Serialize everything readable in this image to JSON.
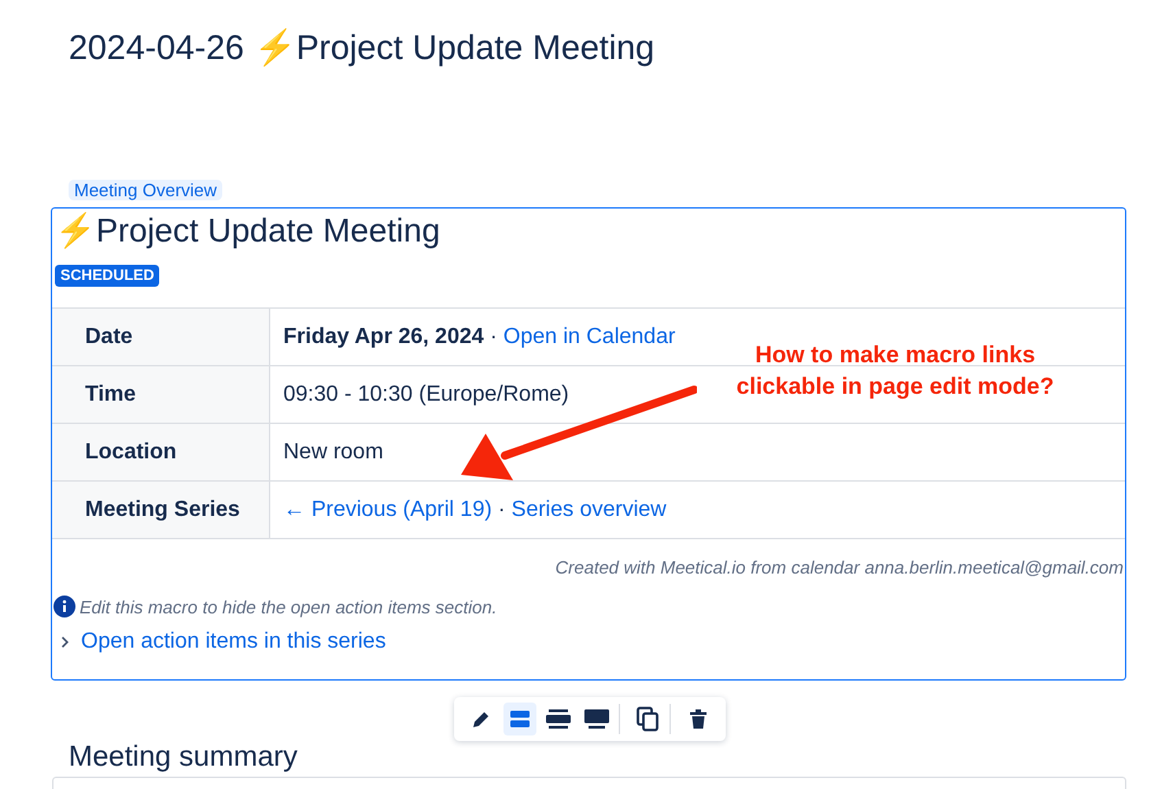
{
  "page_title": "2024-04-26 ⚡Project Update Meeting",
  "macro": {
    "label": "Meeting Overview",
    "heading": "⚡Project Update Meeting",
    "status": "SCHEDULED",
    "rows": [
      {
        "label": "Date",
        "value": [
          {
            "kind": "bold",
            "text": "Friday Apr 26, 2024"
          },
          {
            "kind": "text",
            "text": " · "
          },
          {
            "kind": "link",
            "text": "Open in Calendar"
          }
        ]
      },
      {
        "label": "Time",
        "value": [
          {
            "kind": "text",
            "text": "09:30 - 10:30 (Europe/Rome)"
          }
        ]
      },
      {
        "label": "Location",
        "value": [
          {
            "kind": "text",
            "text": "New room"
          }
        ]
      },
      {
        "label": "Meeting Series",
        "value": [
          {
            "kind": "link",
            "text": "← Previous (April 19)"
          },
          {
            "kind": "text",
            "text": " · "
          },
          {
            "kind": "link",
            "text": "Series overview"
          }
        ]
      }
    ],
    "footer": "Created with Meetical.io from calendar anna.berlin.meetical@gmail.com",
    "info_note": "Edit this macro to hide the open action items section.",
    "expander": {
      "label": "Open action items in this series",
      "expanded": false
    }
  },
  "annotation": {
    "lines": [
      "How to make macro links",
      "clickable in page edit mode?"
    ]
  },
  "toolbar": [
    {
      "kind": "edit",
      "selected": false
    },
    {
      "kind": "default-width",
      "selected": true
    },
    {
      "kind": "wide",
      "selected": false
    },
    {
      "kind": "full-width",
      "selected": false
    },
    {
      "kind": "copy",
      "selected": false
    },
    {
      "kind": "delete",
      "selected": false
    }
  ],
  "section_heading": "Meeting summary"
}
